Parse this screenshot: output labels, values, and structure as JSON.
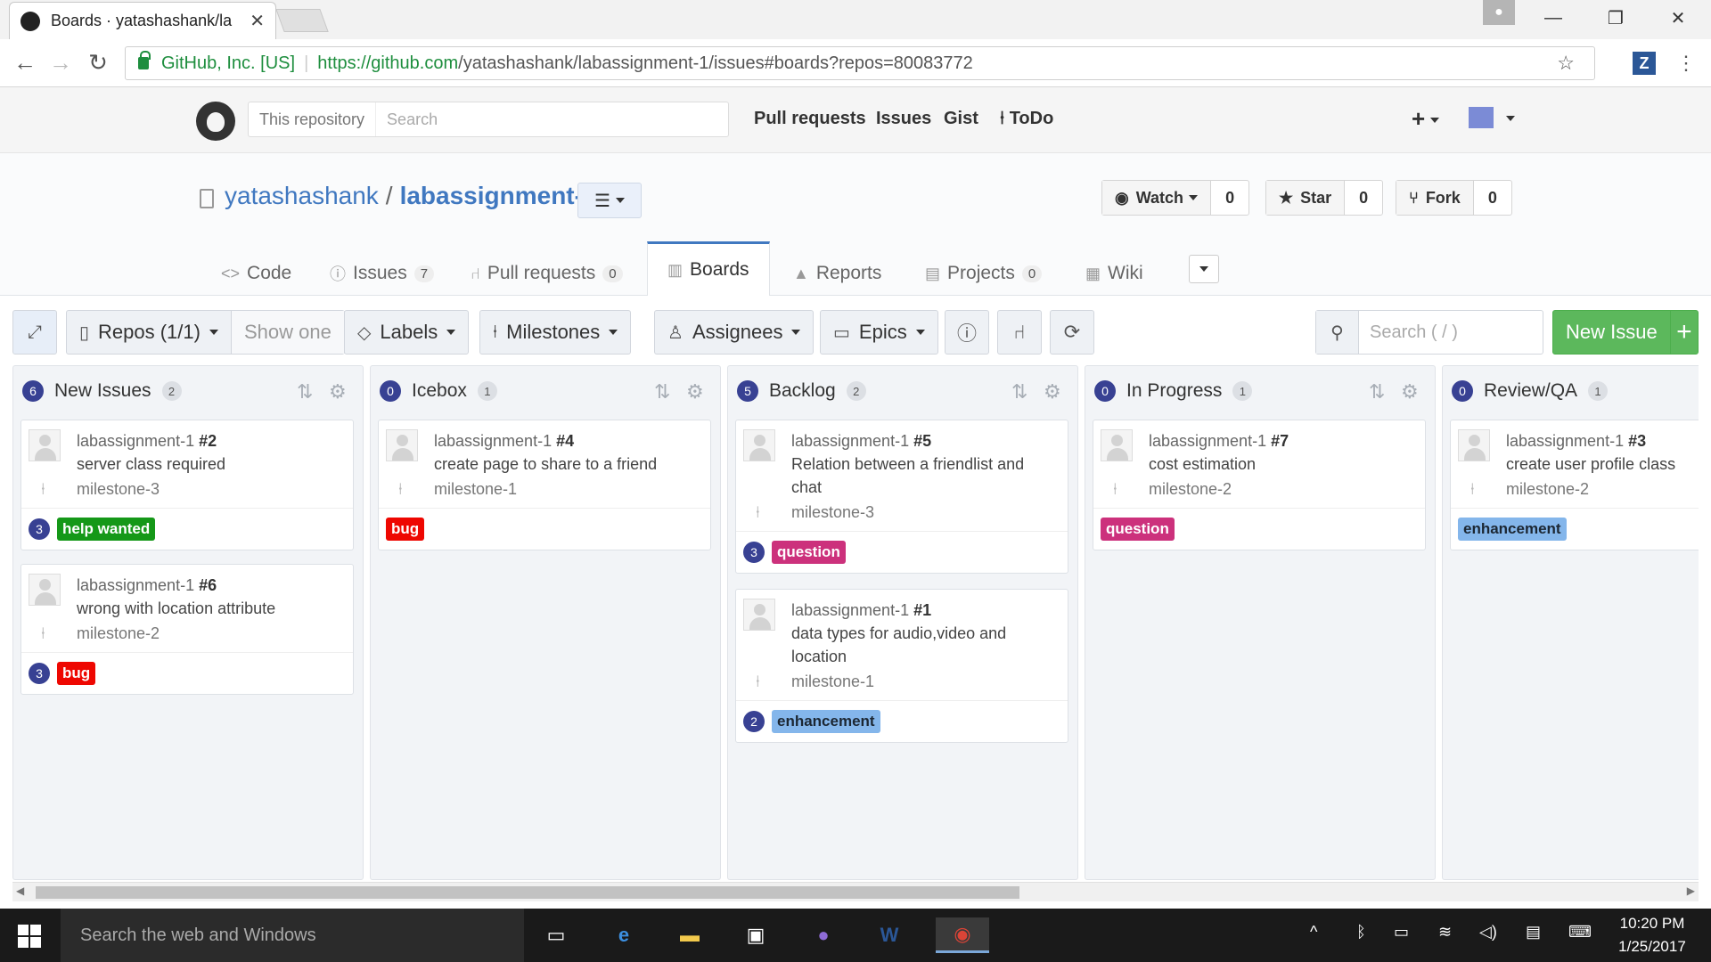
{
  "browser": {
    "tab_title": "Boards · yatashashank/la",
    "tab_close": "✕",
    "secure_label": "GitHub, Inc. [US]",
    "url_host": "https://github.com",
    "url_path": "/yatashashank/labassignment-1/issues#boards?repos=80083772",
    "extension": "Z",
    "min": "—",
    "max": "❐",
    "close": "✕"
  },
  "github_header": {
    "search_scope": "This repository",
    "search_placeholder": "Search",
    "nav": [
      "Pull requests",
      "Issues",
      "Gist",
      "ToDo"
    ],
    "plus": "+"
  },
  "repo": {
    "owner": "yatashashank",
    "slash": "/",
    "name": "labassignment-1",
    "watch_label": "Watch",
    "watch_count": "0",
    "star_label": "Star",
    "star_count": "0",
    "fork_label": "Fork",
    "fork_count": "0",
    "tabs": {
      "code": "Code",
      "issues": "Issues",
      "issues_count": "7",
      "pulls": "Pull requests",
      "pulls_count": "0",
      "boards": "Boards",
      "reports": "Reports",
      "projects": "Projects",
      "projects_count": "0",
      "wiki": "Wiki"
    }
  },
  "toolbar": {
    "repos": "Repos (1/1)",
    "show_one": "Show one",
    "labels": "Labels",
    "milestones": "Milestones",
    "assignees": "Assignees",
    "epics": "Epics",
    "search_placeholder": "Search ( / )",
    "new_issue": "New Issue",
    "new_issue_plus": "+"
  },
  "columns": [
    {
      "estimate": "6",
      "name": "New Issues",
      "count": "2",
      "cards": [
        {
          "repo": "labassignment-1",
          "number": "#2",
          "title": "server class required",
          "milestone": "milestone-3",
          "estimate": "3",
          "label": "help wanted"
        },
        {
          "repo": "labassignment-1",
          "number": "#6",
          "title": "wrong with location attribute",
          "milestone": "milestone-2",
          "estimate": "3",
          "label": "bug"
        }
      ]
    },
    {
      "estimate": "0",
      "name": "Icebox",
      "count": "1",
      "cards": [
        {
          "repo": "labassignment-1",
          "number": "#4",
          "title": "create page to share to a friend",
          "milestone": "milestone-1",
          "label": "bug"
        }
      ]
    },
    {
      "estimate": "5",
      "name": "Backlog",
      "count": "2",
      "cards": [
        {
          "repo": "labassignment-1",
          "number": "#5",
          "title": "Relation between a friendlist and chat",
          "milestone": "milestone-3",
          "estimate": "3",
          "label": "question"
        },
        {
          "repo": "labassignment-1",
          "number": "#1",
          "title": "data types for audio,video and location",
          "milestone": "milestone-1",
          "estimate": "2",
          "label": "enhancement"
        }
      ]
    },
    {
      "estimate": "0",
      "name": "In Progress",
      "count": "1",
      "cards": [
        {
          "repo": "labassignment-1",
          "number": "#7",
          "title": "cost estimation",
          "milestone": "milestone-2",
          "label": "question"
        }
      ]
    },
    {
      "estimate": "0",
      "name": "Review/QA",
      "count": "1",
      "cards": [
        {
          "repo": "labassignment-1",
          "number": "#3",
          "title": "create user profile class",
          "milestone": "milestone-2",
          "label": "enhancement"
        }
      ]
    }
  ],
  "label_colors": {
    "help wanted": "#159818",
    "bug": "#ee0701",
    "question": "#cc317c",
    "enhancement": "#84b6eb"
  },
  "taskbar": {
    "search_placeholder": "Search the web and Windows",
    "time": "10:20 PM",
    "date": "1/25/2017"
  }
}
